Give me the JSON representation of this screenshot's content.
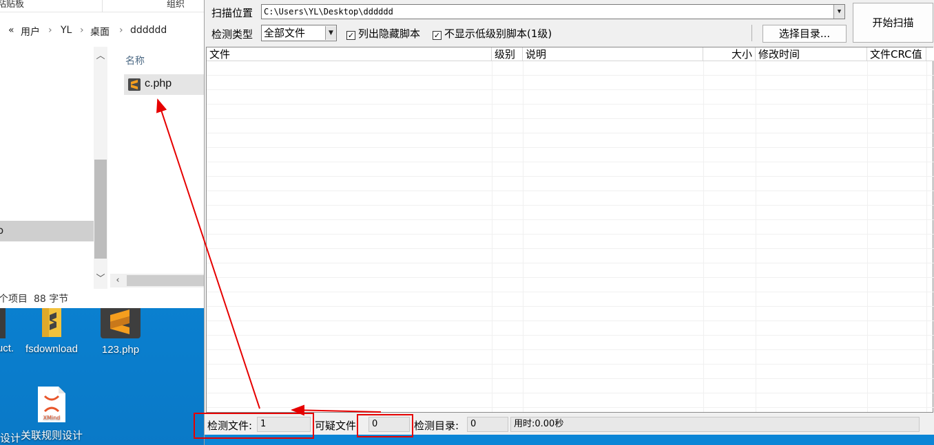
{
  "explorer": {
    "ribbon_left": "粘贴板",
    "ribbon_right": "组织",
    "address": {
      "back": "«",
      "parts": [
        "用户",
        "YL",
        "桌面",
        "dddddd"
      ],
      "sep": "›"
    },
    "files_header": "名称",
    "file": "c.php",
    "status": [
      "个项目",
      "88 字节"
    ],
    "nav_selected_text": "o"
  },
  "desktop": {
    "icons": [
      {
        "label": "uct."
      },
      {
        "label": "fsdownload"
      },
      {
        "label": "123.php"
      },
      {
        "label": "设计"
      },
      {
        "label": "关联规则设计"
      }
    ],
    "xmind_text": "XMind"
  },
  "scanner": {
    "scan_location_label": "扫描位置",
    "scan_path": "C:\\Users\\YL\\Desktop\\dddddd",
    "check_type_label": "检测类型",
    "check_type_value": "全部文件",
    "opt_hidden": "列出隐藏脚本",
    "opt_hide_low": "不显示低级别脚本(1级)",
    "select_dir_button": "选择目录...",
    "start_button": "开始扫描",
    "columns": [
      "文件",
      "级别",
      "说明",
      "大小",
      "修改时间",
      "文件CRC值"
    ],
    "status": {
      "checked_files_label": "检测文件:",
      "checked_files_value": "1",
      "suspicious_label": "可疑文件",
      "suspicious_value": "0",
      "checked_dirs_label": "检测目录:",
      "checked_dirs_value": "0",
      "elapsed_label": "用时:0.00秒"
    }
  },
  "colors": {
    "annotation": "#e60000",
    "desktop": "#0b85d6"
  }
}
